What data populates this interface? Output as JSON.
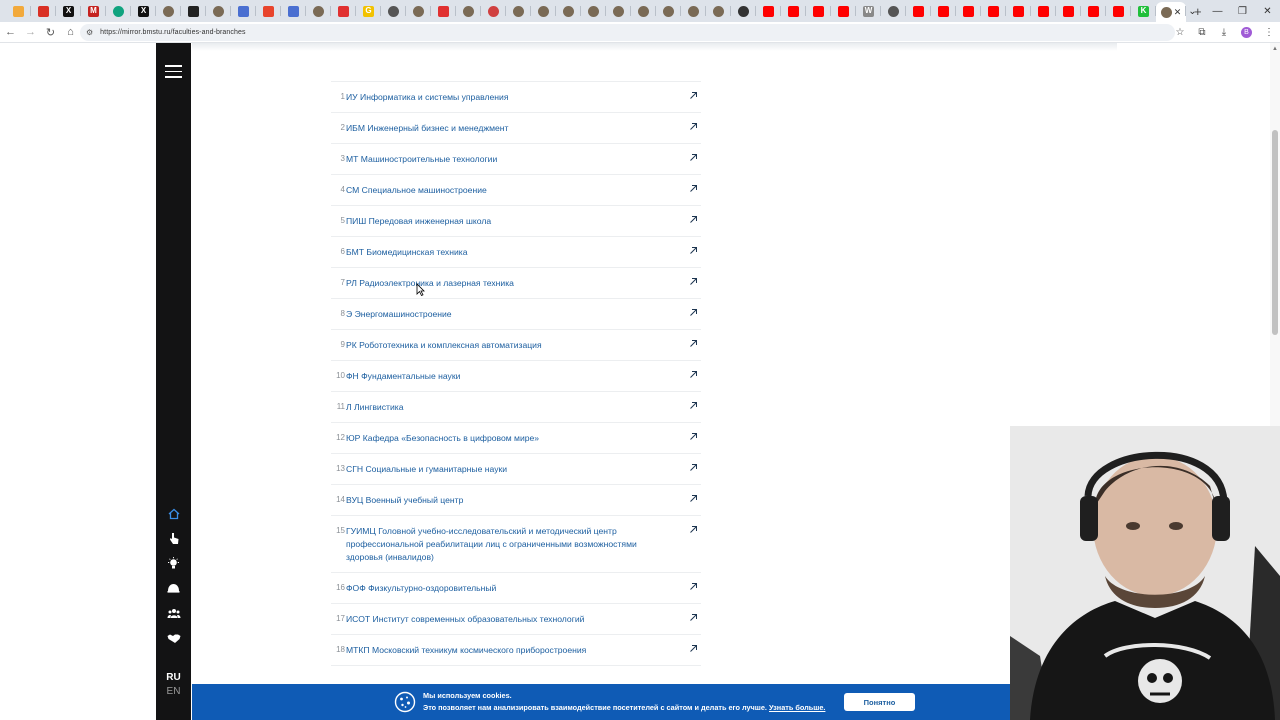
{
  "browser": {
    "tabs": [
      {
        "icon": "generic-favicon",
        "color": "#f2a93b"
      },
      {
        "icon": "mail-favicon",
        "color": "#d93025"
      },
      {
        "icon": "x-favicon",
        "color": "#111111",
        "glyph": "X"
      },
      {
        "icon": "gmail-favicon",
        "color": "#c5221f",
        "glyph": "M"
      },
      {
        "icon": "chatgpt-favicon",
        "color": "#10a37f"
      },
      {
        "icon": "x-favicon",
        "color": "#111111",
        "glyph": "X"
      },
      {
        "icon": "round-favicon",
        "color": "#7a6a55"
      },
      {
        "icon": "terminal-favicon",
        "color": "#222222"
      },
      {
        "icon": "round-favicon",
        "color": "#7a6a55"
      },
      {
        "icon": "docs-favicon",
        "color": "#4a6fd1"
      },
      {
        "icon": "bookmark-favicon",
        "color": "#e8442c"
      },
      {
        "icon": "docs-favicon",
        "color": "#4a6fd1"
      },
      {
        "icon": "round-favicon",
        "color": "#7a6a55"
      },
      {
        "icon": "record-favicon",
        "color": "#e03030"
      },
      {
        "icon": "google-favicon",
        "color": "#f2c200",
        "glyph": "G"
      },
      {
        "icon": "round-favicon",
        "color": "#555555"
      },
      {
        "icon": "round-favicon",
        "color": "#7a6a55"
      },
      {
        "icon": "record-favicon",
        "color": "#e03030"
      },
      {
        "icon": "round-favicon",
        "color": "#7a6a55"
      },
      {
        "icon": "round-favicon",
        "color": "#d04040"
      },
      {
        "icon": "round-favicon",
        "color": "#7a6a55"
      },
      {
        "icon": "round-favicon",
        "color": "#7a6a55"
      },
      {
        "icon": "round-favicon",
        "color": "#7a6a55"
      },
      {
        "icon": "round-favicon",
        "color": "#7a6a55"
      },
      {
        "icon": "round-favicon",
        "color": "#7a6a55"
      },
      {
        "icon": "round-favicon",
        "color": "#7a6a55"
      },
      {
        "icon": "round-favicon",
        "color": "#7a6a55"
      },
      {
        "icon": "round-favicon",
        "color": "#7a6a55"
      },
      {
        "icon": "round-favicon",
        "color": "#7a6a55"
      },
      {
        "icon": "round-favicon",
        "color": "#333333"
      },
      {
        "icon": "youtube-favicon",
        "color": "#ff0000"
      },
      {
        "icon": "youtube-favicon",
        "color": "#ff0000"
      },
      {
        "icon": "youtube-favicon",
        "color": "#ff0000"
      },
      {
        "icon": "youtube-favicon",
        "color": "#ff0000"
      },
      {
        "icon": "wiki-favicon",
        "color": "#888888",
        "glyph": "W"
      },
      {
        "icon": "round-favicon",
        "color": "#555555"
      },
      {
        "icon": "youtube-favicon",
        "color": "#ff0000"
      },
      {
        "icon": "youtube-favicon",
        "color": "#ff0000"
      },
      {
        "icon": "youtube-favicon",
        "color": "#ff0000"
      },
      {
        "icon": "youtube-favicon",
        "color": "#ff0000"
      },
      {
        "icon": "youtube-favicon",
        "color": "#ff0000"
      },
      {
        "icon": "youtube-favicon",
        "color": "#ff0000"
      },
      {
        "icon": "youtube-favicon",
        "color": "#ff0000"
      },
      {
        "icon": "youtube-favicon",
        "color": "#ff0000"
      },
      {
        "icon": "youtube-favicon",
        "color": "#ff0000"
      },
      {
        "icon": "kinopoisk-favicon",
        "color": "#1fbf3a",
        "glyph": "K"
      }
    ],
    "active_tab_icon": "round-favicon",
    "url": "https://mirror.bmstu.ru/faculties-and-branches",
    "profile_initial": "B"
  },
  "colors": {
    "accent": "#1d5fa0",
    "rail": "#131314",
    "cookie_bar": "#0f5bb5",
    "home_icon": "#3a8ee6"
  },
  "sidebar": {
    "icons": [
      "home-icon",
      "hand-pointer-icon",
      "lightbulb-icon",
      "helmet-icon",
      "people-icon",
      "handshake-icon"
    ],
    "lang_ru": "RU",
    "lang_en": "EN"
  },
  "faculties": [
    {
      "num": "1",
      "name": "ИУ Информатика и системы управления"
    },
    {
      "num": "2",
      "name": "ИБМ Инженерный бизнес и менеджмент"
    },
    {
      "num": "3",
      "name": "МТ Машиностроительные технологии"
    },
    {
      "num": "4",
      "name": "СМ Специальное машиностроение"
    },
    {
      "num": "5",
      "name": "ПИШ Передовая инженерная школа"
    },
    {
      "num": "6",
      "name": "БМТ Биомедицинская техника"
    },
    {
      "num": "7",
      "name": "РЛ Радиоэлектроника и лазерная техника"
    },
    {
      "num": "8",
      "name": "Э Энергомашиностроение"
    },
    {
      "num": "9",
      "name": "РК Робототехника и комплексная автоматизация"
    },
    {
      "num": "10",
      "name": "ФН Фундаментальные науки"
    },
    {
      "num": "11",
      "name": "Л Лингвистика"
    },
    {
      "num": "12",
      "name": "ЮР Кафедра «Безопасность в цифровом мире»"
    },
    {
      "num": "13",
      "name": "СГН Социальные и гуманитарные науки"
    },
    {
      "num": "14",
      "name": "ВУЦ Военный учебный центр"
    },
    {
      "num": "15",
      "name": "ГУИМЦ Головной учебно-исследовательский и методический центр профессиональной реабилитации лиц с ограниченными возможностями здоровья (инвалидов)"
    },
    {
      "num": "16",
      "name": "ФОФ Физкультурно-оздоровительный"
    },
    {
      "num": "17",
      "name": "ИСОТ Институт современных образовательных технологий"
    },
    {
      "num": "18",
      "name": "МТКП Московский техникум космического приборостроения"
    }
  ],
  "cookie": {
    "title": "Мы используем cookies.",
    "body": "Это позволяет нам анализировать взаимодействие посетителей с сайтом и делать его лучше.",
    "link": "Узнать больше.",
    "button": "Понятно"
  }
}
